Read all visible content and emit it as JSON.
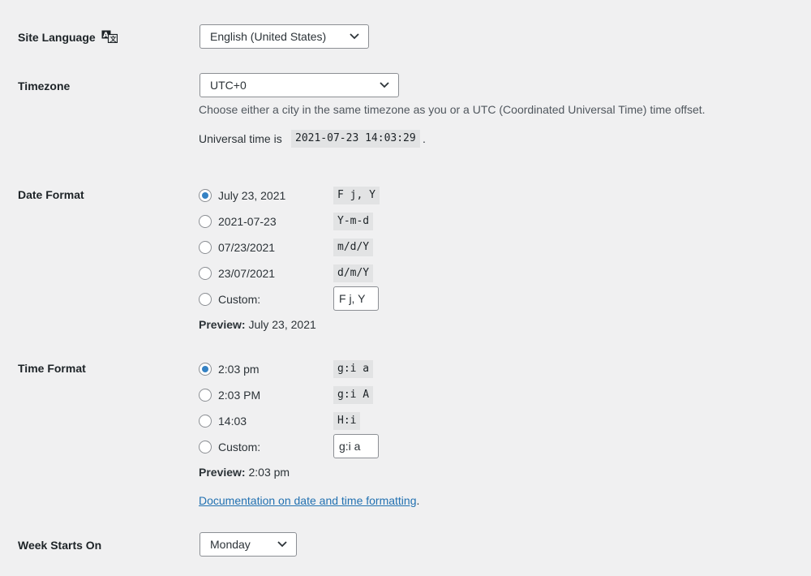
{
  "site_language": {
    "label": "Site Language",
    "icon": "translation-icon",
    "selected": "English (United States)"
  },
  "timezone": {
    "label": "Timezone",
    "selected": "UTC+0",
    "description": "Choose either a city in the same timezone as you or a UTC (Coordinated Universal Time) time offset.",
    "universal_prefix": "Universal time is",
    "universal_value": "2021-07-23 14:03:29",
    "universal_suffix": "."
  },
  "date_format": {
    "label": "Date Format",
    "options": [
      {
        "label": "July 23, 2021",
        "code": "F j, Y",
        "checked": true
      },
      {
        "label": "2021-07-23",
        "code": "Y-m-d",
        "checked": false
      },
      {
        "label": "07/23/2021",
        "code": "m/d/Y",
        "checked": false
      },
      {
        "label": "23/07/2021",
        "code": "d/m/Y",
        "checked": false
      }
    ],
    "custom_label": "Custom:",
    "custom_value": "F j, Y",
    "preview_label": "Preview:",
    "preview_value": "July 23, 2021"
  },
  "time_format": {
    "label": "Time Format",
    "options": [
      {
        "label": "2:03 pm",
        "code": "g:i a",
        "checked": true
      },
      {
        "label": "2:03 PM",
        "code": "g:i A",
        "checked": false
      },
      {
        "label": "14:03",
        "code": "H:i",
        "checked": false
      }
    ],
    "custom_label": "Custom:",
    "custom_value": "g:i a",
    "preview_label": "Preview:",
    "preview_value": "2:03 pm"
  },
  "documentation": {
    "link_text": "Documentation on date and time formatting",
    "suffix": "."
  },
  "week_starts_on": {
    "label": "Week Starts On",
    "selected": "Monday"
  }
}
